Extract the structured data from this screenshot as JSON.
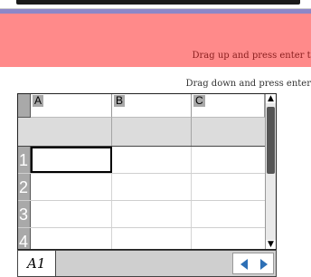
{
  "banner": {
    "hint_text": "Drag up and press enter to s"
  },
  "hint_below": "Drag down and press enter",
  "sheet": {
    "columns": [
      "A",
      "B",
      "C"
    ],
    "formula_marker": "◆",
    "rows": [
      "1",
      "2",
      "3",
      "4"
    ]
  },
  "status": {
    "cell_ref": "A1"
  },
  "colors": {
    "banner": "#ff8a8a",
    "banner_stripe": "#8c87c8",
    "nav_arrow": "#2d6fb5"
  }
}
